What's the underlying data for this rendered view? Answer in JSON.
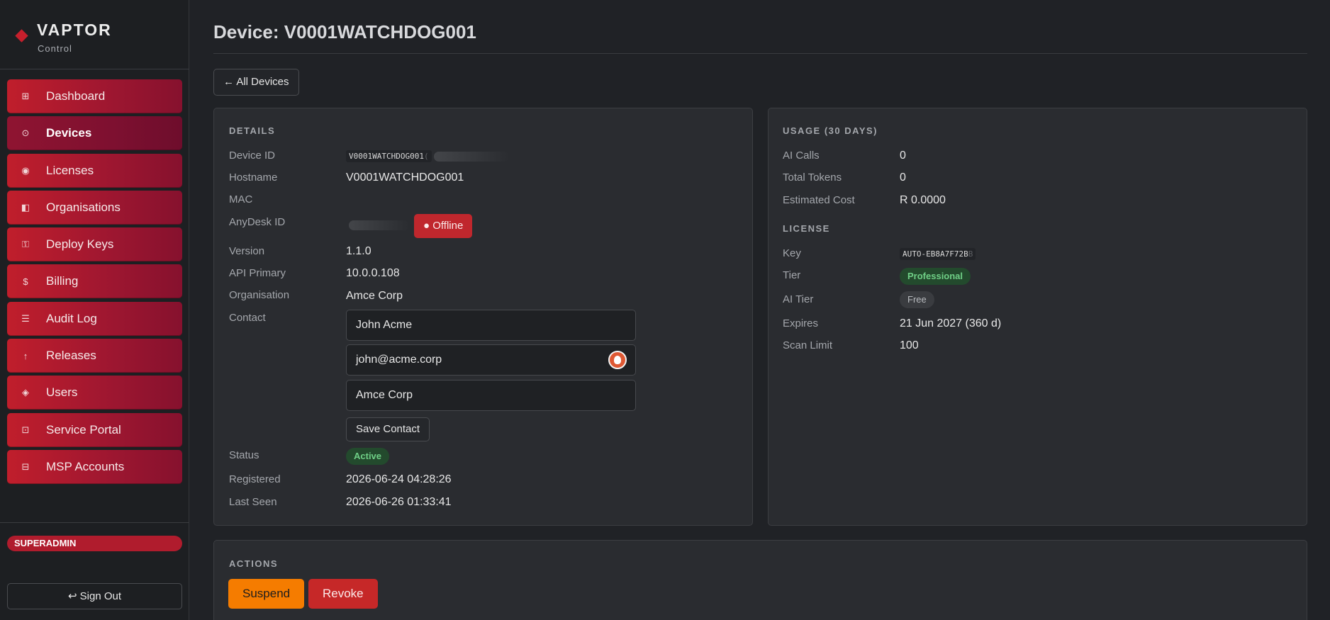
{
  "brand": {
    "name": "VAPTOR",
    "subtitle": "Control"
  },
  "sidebar": {
    "items": [
      {
        "label": "Dashboard",
        "icon": "⊞",
        "icon_name": "dashboard-icon"
      },
      {
        "label": "Devices",
        "icon": "⊙",
        "icon_name": "devices-icon",
        "active": true
      },
      {
        "label": "Licenses",
        "icon": "◉",
        "icon_name": "licenses-icon"
      },
      {
        "label": "Organisations",
        "icon": "◧",
        "icon_name": "organisations-icon"
      },
      {
        "label": "Deploy Keys",
        "icon": "⚿",
        "icon_name": "key-icon"
      },
      {
        "label": "Billing",
        "icon": "$",
        "icon_name": "billing-icon"
      },
      {
        "label": "Audit Log",
        "icon": "☰",
        "icon_name": "audit-log-icon"
      },
      {
        "label": "Releases",
        "icon": "↑",
        "icon_name": "releases-icon"
      },
      {
        "label": "Users",
        "icon": "◈",
        "icon_name": "users-icon"
      },
      {
        "label": "Service Portal",
        "icon": "⊡",
        "icon_name": "service-portal-icon"
      },
      {
        "label": "MSP Accounts",
        "icon": "⊟",
        "icon_name": "msp-accounts-icon"
      }
    ],
    "role_badge": "SUPERADMIN",
    "sign_out": "↩ Sign Out"
  },
  "page": {
    "title": "Device: V0001WATCHDOG001",
    "back_label": "← All Devices"
  },
  "details": {
    "section_title": "DETAILS",
    "device_id_label": "Device ID",
    "device_id_value": "V0001WATCHDOG001",
    "device_id_tail": "(",
    "hostname_label": "Hostname",
    "hostname_value": "V0001WATCHDOG001",
    "mac_label": "MAC",
    "anydesk_label": "AnyDesk ID",
    "anydesk_status": "● Offline",
    "version_label": "Version",
    "version_value": "1.1.0",
    "api_primary_label": "API Primary",
    "api_primary_value": "10.0.0.108",
    "organisation_label": "Organisation",
    "organisation_value": "Amce Corp",
    "contact_label": "Contact",
    "contact_name": "John Acme",
    "contact_email": "john@acme.corp",
    "contact_company": "Amce Corp",
    "save_contact_label": "Save Contact",
    "status_label": "Status",
    "status_value": "Active",
    "registered_label": "Registered",
    "registered_value": "2026-06-24 04:28:26",
    "last_seen_label": "Last Seen",
    "last_seen_value": "2026-06-26 01:33:41"
  },
  "usage": {
    "section_title": "USAGE (30 DAYS)",
    "ai_calls_label": "AI Calls",
    "ai_calls_value": "0",
    "total_tokens_label": "Total Tokens",
    "total_tokens_value": "0",
    "estimated_cost_label": "Estimated Cost",
    "estimated_cost_value": "R 0.0000"
  },
  "license": {
    "section_title": "LICENSE",
    "key_label": "Key",
    "key_value": "AUTO-EB8A7F72B",
    "key_tail": "B",
    "tier_label": "Tier",
    "tier_value": "Professional",
    "ai_tier_label": "AI Tier",
    "ai_tier_value": "Free",
    "expires_label": "Expires",
    "expires_value": "21 Jun 2027 (360 d)",
    "scan_limit_label": "Scan Limit",
    "scan_limit_value": "100"
  },
  "actions": {
    "section_title": "ACTIONS",
    "suspend_label": "Suspend",
    "revoke_label": "Revoke"
  },
  "colors": {
    "nav_gradient_start": "#c01e2c",
    "nav_gradient_end": "#86112e",
    "offline": "#c0272d",
    "suspend": "#f57c00",
    "revoke": "#c62828",
    "badge_green_text": "#6fcf86"
  }
}
